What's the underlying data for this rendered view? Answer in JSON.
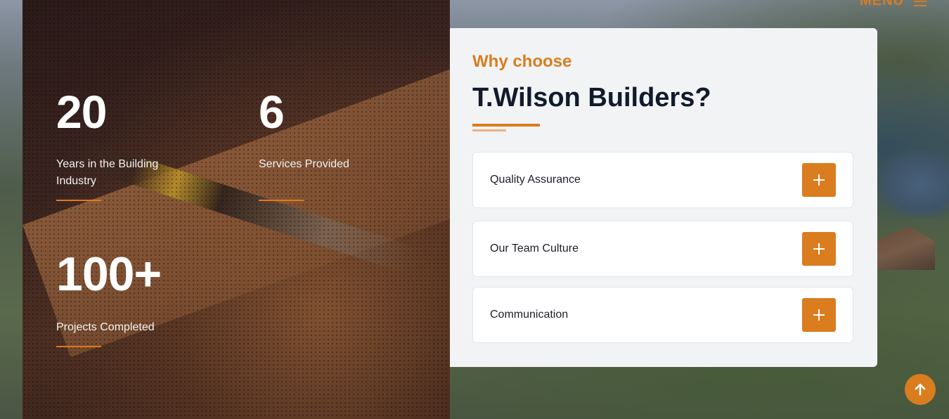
{
  "header": {
    "menu_label": "MENU"
  },
  "stats": [
    {
      "number": "20",
      "label": "Years in the Building Industry"
    },
    {
      "number": "6",
      "label": "Services Provided"
    },
    {
      "number": "100+",
      "label": "Projects Completed"
    }
  ],
  "why_choose": {
    "eyebrow": "Why choose",
    "title": "T.Wilson Builders?",
    "items": [
      {
        "label": "Quality Assurance"
      },
      {
        "label": "Our Team Culture"
      },
      {
        "label": "Communication"
      }
    ]
  },
  "colors": {
    "accent": "#d97d1f",
    "title": "#121a2c",
    "card_bg": "#f2f3f5"
  },
  "icons": {
    "expand": "plus-icon",
    "menu": "hamburger-icon",
    "scroll_top": "arrow-up-icon"
  }
}
